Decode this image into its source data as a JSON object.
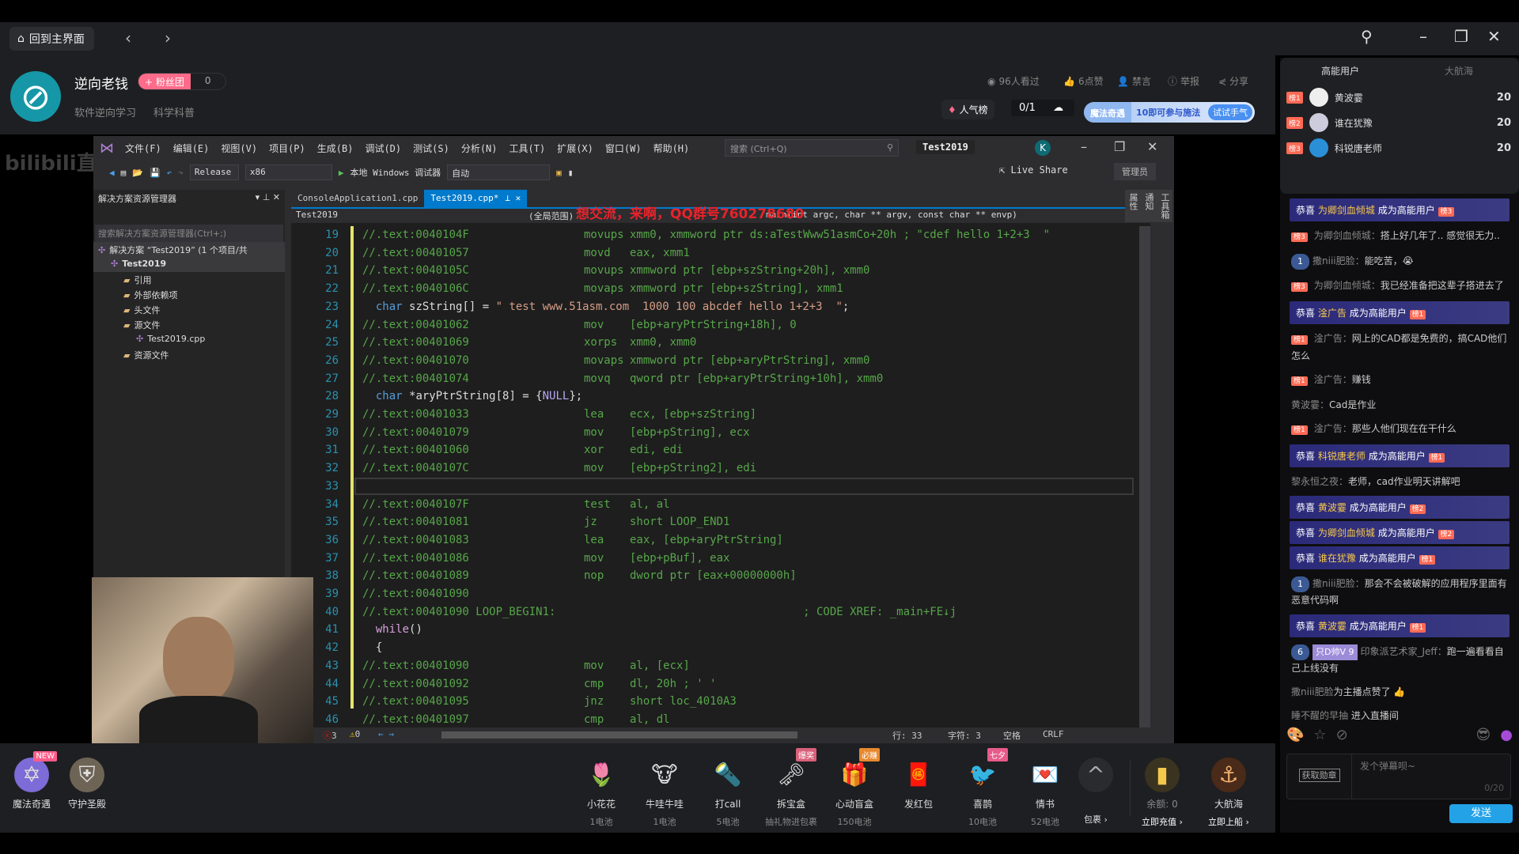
{
  "topbar": {
    "home_label": "回到主界面",
    "back_icon": "chevron-left-icon",
    "forward_icon": "chevron-right-icon"
  },
  "header": {
    "streamer": "逆向老钱",
    "fan_button": "+ 粉丝团",
    "fan_count": "0",
    "tags": [
      "软件逆向学习",
      "科学科普"
    ],
    "stats": {
      "views": "96人看过",
      "likes": "6点赞",
      "mute": "禁言",
      "report": "举报",
      "share": "分享"
    },
    "popularity": "人气榜",
    "ratio": "0/1",
    "magic": {
      "title": "魔法奇遇",
      "desc": "10即可参与施法",
      "try": "试试手气"
    }
  },
  "video": {
    "bili_watermark": "bilibili直播",
    "overlay_text": "想交流，来啊，QQ群号760278680"
  },
  "vs": {
    "menus": [
      "文件(F)",
      "编辑(E)",
      "视图(V)",
      "项目(P)",
      "生成(B)",
      "调试(D)",
      "测试(S)",
      "分析(N)",
      "工具(T)",
      "扩展(X)",
      "窗口(W)",
      "帮助(H)"
    ],
    "search_placeholder": "搜索 (Ctrl+Q)",
    "project": "Test2019",
    "user_initial": "K",
    "toolbar": {
      "config": "Release",
      "platform": "x86",
      "debugger": "本地 Windows 调试器",
      "mode": "自动",
      "live_share": "Live Share",
      "admin": "管理员"
    },
    "solution_explorer": {
      "title": "解决方案资源管理器",
      "search": "搜索解决方案资源管理器(Ctrl+;)",
      "tree": [
        {
          "label": "解决方案 “Test2019” (1 个项目/共",
          "depth": 0
        },
        {
          "label": "Test2019",
          "depth": 1
        },
        {
          "label": "引用",
          "depth": 2
        },
        {
          "label": "外部依赖项",
          "depth": 2
        },
        {
          "label": "头文件",
          "depth": 2
        },
        {
          "label": "源文件",
          "depth": 2
        },
        {
          "label": "Test2019.cpp",
          "depth": 3
        },
        {
          "label": "资源文件",
          "depth": 2
        }
      ]
    },
    "tabs": [
      {
        "label": "ConsoleApplication1.cpp",
        "active": false
      },
      {
        "label": "Test2019.cpp*",
        "active": true
      }
    ],
    "nav": {
      "project": "Test2019",
      "scope": "(全局范围)",
      "function": "main(int argc, char ** argv, const char ** envp)"
    },
    "side_tabs": [
      "工具箱",
      "通知",
      "属性"
    ],
    "code": [
      {
        "n": "19",
        "addr": "//.text:0040104F",
        "op": "movups",
        "args": "xmm0, xmmword ptr ds:aTestWww51asmCo+20h ; \"cdef hello 1+2+3  \""
      },
      {
        "n": "20",
        "addr": "//.text:00401057",
        "op": "movd",
        "args": "eax, xmm1"
      },
      {
        "n": "21",
        "addr": "//.text:0040105C",
        "op": "movups",
        "args": "xmmword ptr [ebp+szString+20h], xmm0"
      },
      {
        "n": "22",
        "addr": "//.text:0040106C",
        "op": "movaps",
        "args": "xmmword ptr [ebp+szString], xmm1"
      },
      {
        "n": "23",
        "src": [
          [
            "kw",
            "  char "
          ],
          [
            "id",
            "szString[] = "
          ],
          [
            "str",
            "\" test www.51asm.com  1000 100 abcdef hello 1+2+3  \""
          ],
          [
            "id",
            ";"
          ]
        ]
      },
      {
        "n": "24",
        "addr": "//.text:00401062",
        "op": "mov",
        "args": "[ebp+aryPtrString+18h], 0"
      },
      {
        "n": "25",
        "addr": "//.text:00401069",
        "op": "xorps",
        "args": "xmm0, xmm0"
      },
      {
        "n": "26",
        "addr": "//.text:00401070",
        "op": "movaps",
        "args": "xmmword ptr [ebp+aryPtrString], xmm0"
      },
      {
        "n": "27",
        "addr": "//.text:00401074",
        "op": "movq",
        "args": "qword ptr [ebp+aryPtrString+10h], xmm0"
      },
      {
        "n": "28",
        "src": [
          [
            "kw",
            "  char "
          ],
          [
            "id",
            "*aryPtrString[8] = {"
          ],
          [
            "mac",
            "NULL"
          ],
          [
            "id",
            "};"
          ]
        ]
      },
      {
        "n": "29",
        "addr": "//.text:00401033",
        "op": "lea",
        "args": "ecx, [ebp+szString]"
      },
      {
        "n": "30",
        "addr": "//.text:00401079",
        "op": "mov",
        "args": "[ebp+pString], ecx"
      },
      {
        "n": "31",
        "addr": "//.text:00401060",
        "op": "xor",
        "args": "edi, edi"
      },
      {
        "n": "32",
        "addr": "//.text:0040107C",
        "op": "mov",
        "args": "[ebp+pString2], edi"
      },
      {
        "n": "33",
        "src": [
          [
            "id",
            "  "
          ]
        ]
      },
      {
        "n": "34",
        "addr": "//.text:0040107F",
        "op": "test",
        "args": "al, al"
      },
      {
        "n": "35",
        "addr": "//.text:00401081",
        "op": "jz",
        "args": "short LOOP_END1"
      },
      {
        "n": "36",
        "addr": "//.text:00401083",
        "op": "lea",
        "args": "eax, [ebp+aryPtrString]"
      },
      {
        "n": "37",
        "addr": "//.text:00401086",
        "op": "mov",
        "args": "[ebp+pBuf], eax"
      },
      {
        "n": "38",
        "addr": "//.text:00401089",
        "op": "nop",
        "args": "dword ptr [eax+00000000h]"
      },
      {
        "n": "39",
        "addr": "//.text:00401090",
        "op": "",
        "args": ""
      },
      {
        "n": "40",
        "addr": "//.text:00401090 LOOP_BEGIN1:",
        "op": "",
        "args": "                          ; CODE XREF: _main+FE↓j"
      },
      {
        "n": "41",
        "src": [
          [
            "ctl",
            "  while"
          ],
          [
            "id",
            "()"
          ]
        ]
      },
      {
        "n": "42",
        "src": [
          [
            "id",
            "  {"
          ]
        ]
      },
      {
        "n": "43",
        "addr": "//.text:00401090",
        "op": "mov",
        "args": "al, [ecx]"
      },
      {
        "n": "44",
        "addr": "//.text:00401092",
        "op": "cmp",
        "args": "dl, 20h ; ' '"
      },
      {
        "n": "45",
        "addr": "//.text:00401095",
        "op": "jnz",
        "args": "short loc_4010A3"
      },
      {
        "n": "46",
        "addr": "//.text:00401097",
        "op": "cmp",
        "args": "al, dl"
      }
    ],
    "status": {
      "errors": "3",
      "warnings": "0",
      "line": "行: 33",
      "char": "字符: 3",
      "spaces": "空格",
      "eol": "CRLF"
    }
  },
  "gifts": {
    "left": [
      {
        "name": "魔法奇遇",
        "badge": "NEW"
      },
      {
        "name": "守护圣殿"
      }
    ],
    "items": [
      {
        "name": "小花花",
        "price": "1电池",
        "icon": "🌷"
      },
      {
        "name": "牛哇牛哇",
        "price": "1电池",
        "icon": "🐮"
      },
      {
        "name": "打call",
        "price": "5电池",
        "icon": "🔦"
      },
      {
        "name": "拆宝盒",
        "price": "抽礼物进包裹",
        "icon": "🗝",
        "badge": "爆奖"
      },
      {
        "name": "心动盲盒",
        "price": "150电池",
        "icon": "🎁",
        "badge": "必赚"
      },
      {
        "name": "发红包",
        "price": "",
        "icon": "🧧"
      },
      {
        "name": "喜鹊",
        "price": "10电池",
        "icon": "🐦",
        "badge": "七夕"
      },
      {
        "name": "情书",
        "price": "52电池",
        "icon": "💌"
      }
    ],
    "package": "包裹 ›",
    "balance": "余额: 0",
    "recharge": "立即充值 ›",
    "voyage": "大航海",
    "board": "立即上船 ›"
  },
  "panel": {
    "tabs": [
      "高能用户",
      "大航海"
    ],
    "ranking": [
      {
        "rank": "榜1",
        "name": "黄波霎",
        "score": "20"
      },
      {
        "rank": "榜2",
        "name": "谁在犹豫",
        "score": "20"
      },
      {
        "rank": "榜3",
        "name": "科锐唐老师",
        "score": "20"
      }
    ],
    "messages": [
      {
        "type": "congrats",
        "pre": "恭喜",
        "user": "为卿剑血倾城",
        "post": "成为高能用户",
        "rank": "榜3"
      },
      {
        "type": "msg",
        "rank": "榜3",
        "user": "为卿剑血倾城：",
        "text": "搭上好几年了.. 感觉很无力.."
      },
      {
        "type": "msg",
        "vip": "1",
        "user": "撒niii肥脸：",
        "text": "能吃苦，😭"
      },
      {
        "type": "msg",
        "rank": "榜3",
        "user": "为卿剑血倾城：",
        "text": "我已经准备把这辈子搭进去了"
      },
      {
        "type": "congrats",
        "pre": "恭喜",
        "user": "淦广告",
        "post": "成为高能用户",
        "rank": "榜1"
      },
      {
        "type": "msg",
        "rank": "榜1",
        "user": "淦广告：",
        "text": "网上的CAD都是免费的，搞CAD他们怎么"
      },
      {
        "type": "msg",
        "rank": "榜1",
        "user": "淦广告：",
        "text": "赚钱"
      },
      {
        "type": "msg",
        "user": "黄波霎：",
        "text": "Cad是作业"
      },
      {
        "type": "msg",
        "rank": "榜1",
        "user": "淦广告：",
        "text": "那些人他们现在在干什么"
      },
      {
        "type": "congrats",
        "pre": "恭喜",
        "user": "科锐唐老师",
        "post": "成为高能用户",
        "rank": "榜1"
      },
      {
        "type": "msg",
        "user": "黎永恒之夜：",
        "text": "老师，cad作业明天讲解吧"
      },
      {
        "type": "congrats",
        "pre": "恭喜",
        "user": "黄波霎",
        "post": "成为高能用户",
        "rank": "榜2"
      },
      {
        "type": "congrats",
        "pre": "恭喜",
        "user": "为卿剑血倾城",
        "post": "成为高能用户",
        "rank": "榜2"
      },
      {
        "type": "congrats",
        "pre": "恭喜",
        "user": "谁在犹豫",
        "post": "成为高能用户",
        "rank": "榜1"
      },
      {
        "type": "msg",
        "vip": "1",
        "user": "撒niii肥脸：",
        "text": "那会不会被破解的应用程序里面有恶意代码啊"
      },
      {
        "type": "congrats",
        "pre": "恭喜",
        "user": "黄波霎",
        "post": "成为高能用户",
        "rank": "榜1"
      },
      {
        "type": "msg",
        "vip": "6",
        "fan": "只D帅V 9",
        "user": "印象派艺术家_Jeff：",
        "text": "跑一遍看看自己上线没有"
      },
      {
        "type": "msg",
        "user": "撒niii肥脸",
        "text": "为主播点赞了 👍"
      },
      {
        "type": "msg",
        "user": "睡不醒的早抽",
        "text": " 进入直播间"
      }
    ],
    "medal": "获取勋章",
    "input_placeholder": "发个弹幕呗~",
    "input_count": "0/20",
    "send": "发送"
  }
}
